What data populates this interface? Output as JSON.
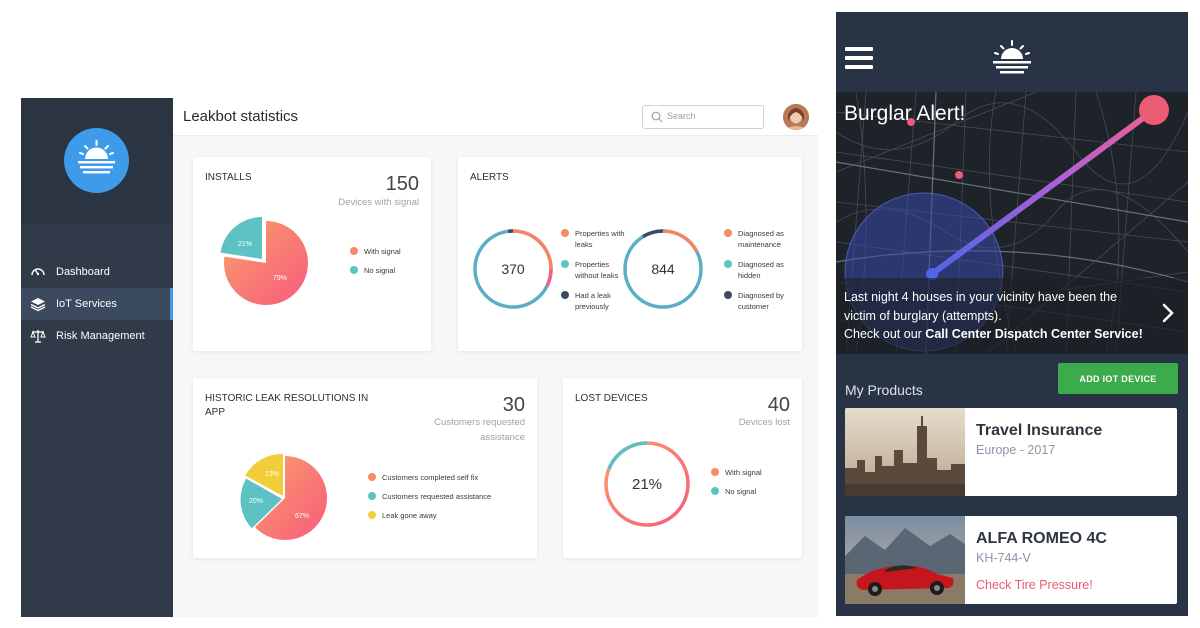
{
  "colors": {
    "sidebar_bg": "#303a48",
    "accent_blue": "#3d9be9",
    "coral": "#f88a68",
    "pink": "#f85f7f",
    "teal": "#5ec1c4",
    "yellow": "#f2cd3a",
    "navy_dot": "#3c4b63",
    "green_button": "#3cab4c",
    "warning_pink": "#ec5a73"
  },
  "sidebar": {
    "items": [
      {
        "label": "Dashboard",
        "icon": "speedometer-icon",
        "active": false
      },
      {
        "label": "IoT Services",
        "icon": "layers-icon",
        "active": true
      },
      {
        "label": "Risk Management",
        "icon": "scales-icon",
        "active": false
      }
    ]
  },
  "header": {
    "title": "Leakbot statistics",
    "search_placeholder": "Search"
  },
  "cards": {
    "installs": {
      "title": "INSTALLS",
      "value": "150",
      "caption": "Devices with signal",
      "legend": [
        "With signal",
        "No signal"
      ],
      "slices": [
        {
          "label": "79%",
          "value": 79
        },
        {
          "label": "21%",
          "value": 21
        }
      ]
    },
    "alerts": {
      "title": "ALERTS",
      "donut_left": {
        "value": "370",
        "legend": [
          "Properties with leaks",
          "Properties without leaks",
          "Had a leak previously"
        ]
      },
      "donut_right": {
        "value": "844",
        "legend": [
          "Diagnosed as maintenance",
          "Diagnosed as hidden",
          "Diagnosed by customer"
        ]
      }
    },
    "historic": {
      "title": "HISTORIC LEAK RESOLUTIONS IN APP",
      "value": "30",
      "caption_line1": "Customers requested",
      "caption_line2": "assistance",
      "legend": [
        "Customers completed self fix",
        "Customers requested assistance",
        "Leak gone away"
      ],
      "slices": [
        {
          "label": "67%",
          "value": 67
        },
        {
          "label": "20%",
          "value": 20
        },
        {
          "label": "13%",
          "value": 13
        }
      ]
    },
    "lost": {
      "title": "LOST DEVICES",
      "value": "40",
      "caption": "Devices lost",
      "donut_value": "21%",
      "legend": [
        "With signal",
        "No signal"
      ]
    }
  },
  "mobile": {
    "alert_title": "Burglar Alert!",
    "alert_line1": "Last night 4 houses in your vicinity have been the",
    "alert_line2": "victim of burglary (attempts).",
    "alert_line3_prefix": "Check out our ",
    "alert_line3_bold": "Call Center Dispatch Center Service!",
    "products_heading": "My Products",
    "add_button": "ADD IOT DEVICE",
    "products": [
      {
        "title": "Travel Insurance",
        "subtitle": "Europe - 2017",
        "warning": ""
      },
      {
        "title": "ALFA ROMEO 4C",
        "subtitle": "KH-744-V",
        "warning": "Check Tire Pressure!"
      }
    ]
  }
}
